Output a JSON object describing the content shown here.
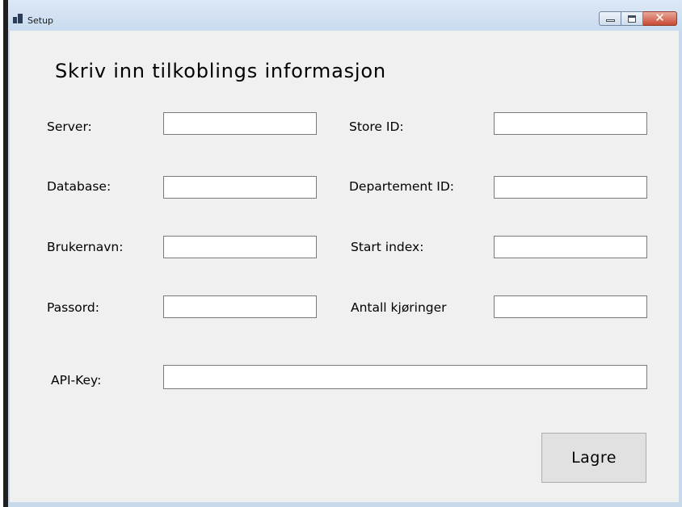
{
  "window": {
    "title": "Setup",
    "close_glyph": "✕"
  },
  "form": {
    "heading": "Skriv inn tilkoblings informasjon",
    "left": [
      {
        "label": "Server:",
        "value": ""
      },
      {
        "label": "Database:",
        "value": ""
      },
      {
        "label": "Brukernavn:",
        "value": ""
      },
      {
        "label": "Passord:",
        "value": ""
      }
    ],
    "right": [
      {
        "label": "Store ID:",
        "value": ""
      },
      {
        "label": "Departement ID:",
        "value": ""
      },
      {
        "label": "Start index:",
        "value": ""
      },
      {
        "label": "Antall kjøringer",
        "value": ""
      }
    ],
    "api_key": {
      "label": "API-Key:",
      "value": ""
    },
    "save_label": "Lagre"
  },
  "icons": {
    "app": "app-window-icon",
    "minimize": "minimize-icon",
    "maximize": "maximize-icon",
    "close": "close-icon"
  }
}
